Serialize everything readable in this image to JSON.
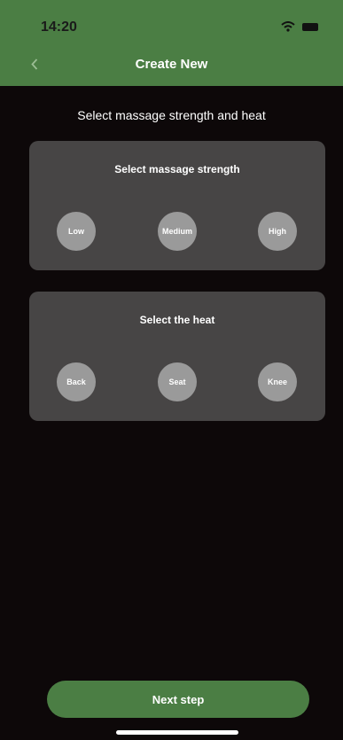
{
  "status_bar": {
    "time": "14:20",
    "icons": [
      "wifi-icon",
      "battery-icon"
    ]
  },
  "header": {
    "title": "Create New",
    "back_icon": "chevron-left-icon"
  },
  "page": {
    "subtitle": "Select massage strength and heat"
  },
  "strength": {
    "title": "Select massage strength",
    "options": [
      "Low",
      "Medium",
      "High"
    ]
  },
  "heat": {
    "title": "Select the heat",
    "options": [
      "Back",
      "Seat",
      "Knee"
    ]
  },
  "footer": {
    "next_label": "Next step"
  },
  "colors": {
    "accent": "#4b7e44",
    "background": "#0d0809",
    "card": "#474545",
    "option": "#9a9a9a"
  }
}
